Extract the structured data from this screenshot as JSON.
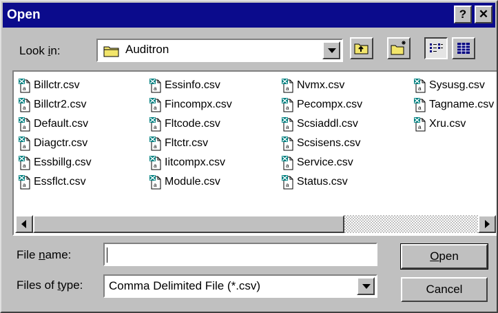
{
  "window": {
    "title": "Open",
    "help_label": "?",
    "close_label": "✕"
  },
  "look_in": {
    "label": "Look in:",
    "value": "Auditron"
  },
  "toolbar": {
    "icons": [
      "up-one-level-icon",
      "create-new-folder-icon",
      "list-view-icon",
      "details-view-icon"
    ]
  },
  "files": {
    "col1": [
      "Billctr.csv",
      "Billctr2.csv",
      "Default.csv",
      "Diagctr.csv",
      "Essbillg.csv",
      "Essflct.csv"
    ],
    "col2": [
      "Essinfo.csv",
      "Fincompx.csv",
      "Fltcode.csv",
      "Fltctr.csv",
      "Iitcompx.csv",
      "Module.csv"
    ],
    "col3": [
      "Nvmx.csv",
      "Pecompx.csv",
      "Scsiaddl.csv",
      "Scsisens.csv",
      "Service.csv",
      "Status.csv"
    ],
    "col4": [
      "Sysusg.csv",
      "Tagname.csv",
      "Xru.csv"
    ]
  },
  "filename": {
    "label": "File name:",
    "value": ""
  },
  "filetype": {
    "label": "Files of type:",
    "value": "Comma Delimited File (*.csv)"
  },
  "buttons": {
    "open": "Open",
    "cancel": "Cancel"
  },
  "scrollbar": {
    "position": 0,
    "visible_fraction": 0.7
  },
  "colors": {
    "title_bar": "#0b0b8c",
    "dialog_face": "#c0c0c0",
    "folder_yellow": "#f2e56b",
    "file_icon_teal": "#008080"
  }
}
